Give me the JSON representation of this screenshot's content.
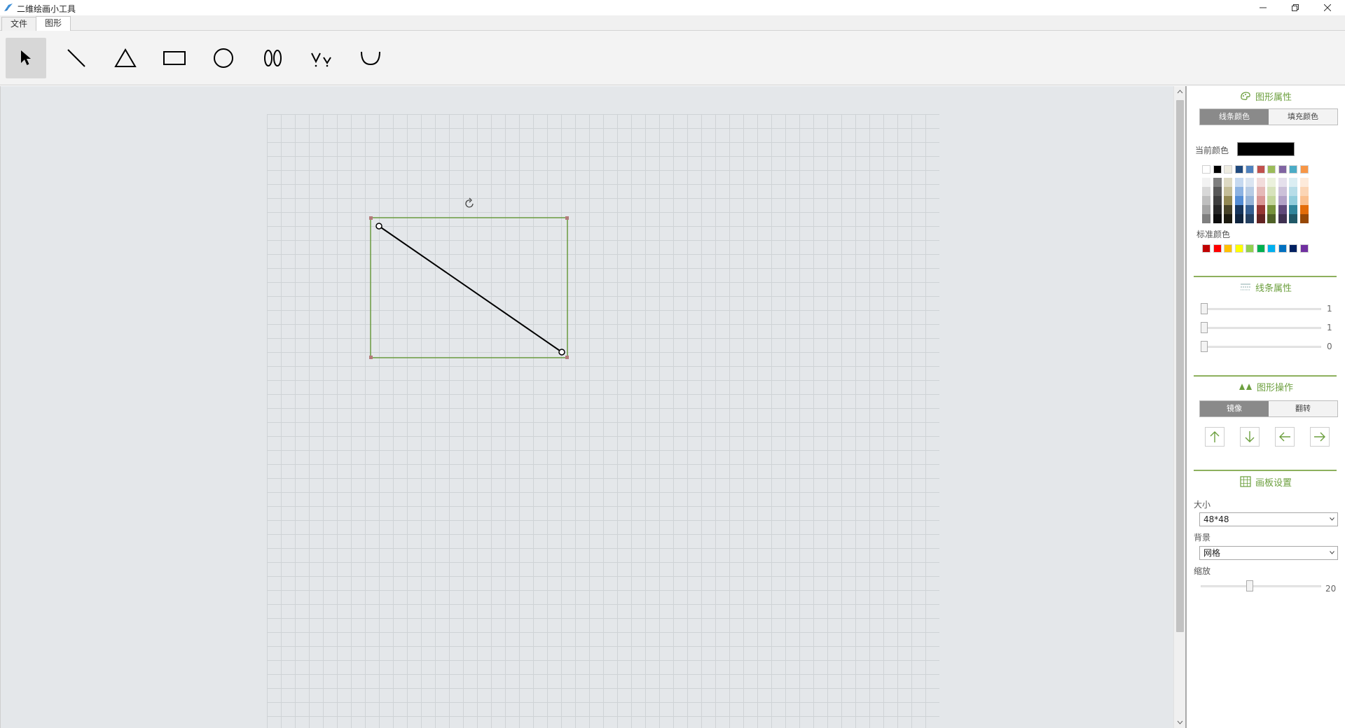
{
  "window": {
    "title": "二维绘画小工具"
  },
  "tabs": {
    "file": "文件",
    "shape": "图形"
  },
  "toolbar": {
    "tools": [
      "select-arrow",
      "line",
      "triangle",
      "rectangle",
      "circle",
      "double-ellipse",
      "angle-marks",
      "arc"
    ],
    "selected": "select-arrow"
  },
  "panel": {
    "shape_props": {
      "title": "图形属性",
      "tab_line_color": "线条颜色",
      "tab_fill_color": "填充颜色",
      "current_color_label": "当前颜色",
      "current_color": "#000000",
      "standard_colors_label": "标准颜色",
      "theme_top": [
        "#ffffff",
        "#000000",
        "#eeece1",
        "#1f497d",
        "#4f81bd",
        "#c0504d",
        "#9bbb59",
        "#8064a2",
        "#4bacc6",
        "#f79646"
      ],
      "theme_tints": [
        [
          "#f2f2f2",
          "#7f7f7f",
          "#ddd9c3",
          "#c6d9f0",
          "#dbe5f1",
          "#f2dcdb",
          "#ebf1dd",
          "#e5e0ec",
          "#dbeef3",
          "#fdeada"
        ],
        [
          "#d8d8d8",
          "#595959",
          "#c4bd97",
          "#8db3e2",
          "#b8cce4",
          "#e5b9b7",
          "#d7e3bc",
          "#ccc1d9",
          "#b7dde8",
          "#fbd5b5"
        ],
        [
          "#bfbfbf",
          "#3f3f3f",
          "#938953",
          "#548dd4",
          "#95b3d7",
          "#d99694",
          "#c3d69b",
          "#b2a2c7",
          "#92cddc",
          "#fac08f"
        ],
        [
          "#a5a5a5",
          "#262626",
          "#494429",
          "#17365d",
          "#366092",
          "#953734",
          "#76923c",
          "#5f497a",
          "#31859b",
          "#e36c09"
        ],
        [
          "#7f7f7f",
          "#0c0c0c",
          "#1d1b10",
          "#0f243e",
          "#244061",
          "#632423",
          "#4f6128",
          "#3f3151",
          "#205867",
          "#974806"
        ]
      ],
      "standard": [
        "#c00000",
        "#ff0000",
        "#ffc000",
        "#ffff00",
        "#92d050",
        "#00b050",
        "#00b0f0",
        "#0070c0",
        "#002060",
        "#7030a0"
      ]
    },
    "line_props": {
      "title": "线条属性",
      "values": [
        "1",
        "1",
        "0"
      ]
    },
    "shape_ops": {
      "title": "图形操作",
      "tab_mirror": "镜像",
      "tab_flip": "翻转"
    },
    "board": {
      "title": "画板设置",
      "size_label": "大小",
      "size_value": "48*48",
      "bg_label": "背景",
      "bg_value": "网格",
      "zoom_label": "缩放",
      "zoom_value": "20",
      "zoom_fraction": 0.4
    }
  }
}
